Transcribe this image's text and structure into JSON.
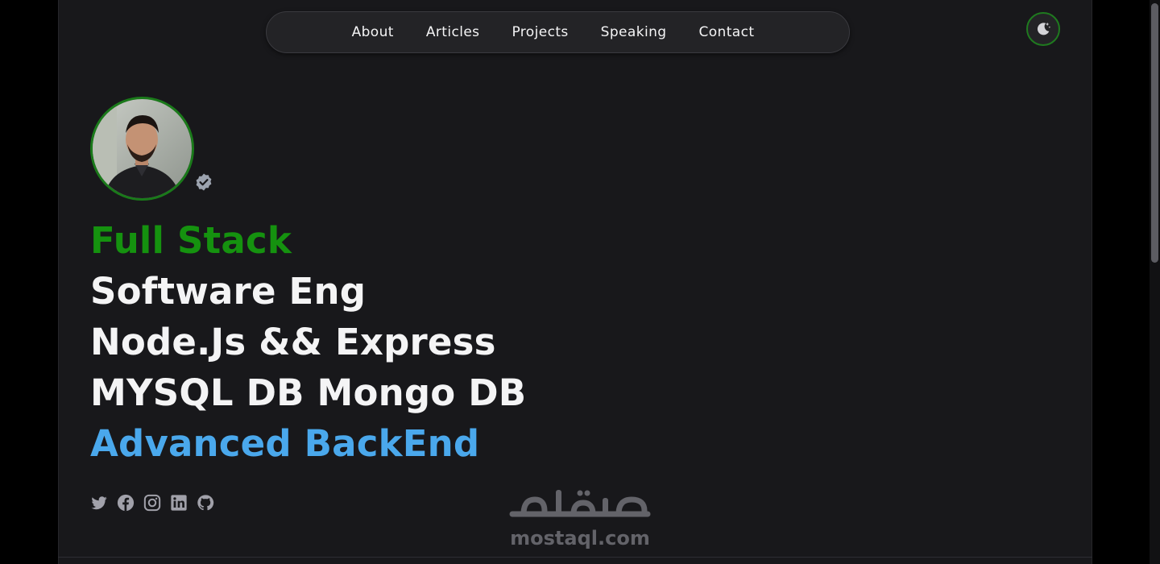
{
  "nav": {
    "items": [
      {
        "label": "About"
      },
      {
        "label": "Articles"
      },
      {
        "label": "Projects"
      },
      {
        "label": "Speaking"
      },
      {
        "label": "Contact"
      }
    ]
  },
  "theme_toggle": {
    "icon": "moon-icon"
  },
  "profile": {
    "avatar_icon": "avatar-photo",
    "badge_icon": "verified-badge-icon"
  },
  "hero": {
    "line1": "Full Stack",
    "line2": "Software Eng",
    "line3": "Node.Js && Express",
    "line4": "MYSQL DB Mongo DB",
    "line5": "Advanced BackEnd"
  },
  "socials": [
    {
      "icon": "twitter-icon"
    },
    {
      "icon": "facebook-icon"
    },
    {
      "icon": "instagram-icon"
    },
    {
      "icon": "linkedin-icon"
    },
    {
      "icon": "github-icon"
    }
  ],
  "watermark": {
    "text": "mostaql.com"
  },
  "colors": {
    "background": "#18181b",
    "accent_green": "#15920f",
    "accent_blue": "#4aa8ec",
    "text": "#f4f4f5"
  }
}
